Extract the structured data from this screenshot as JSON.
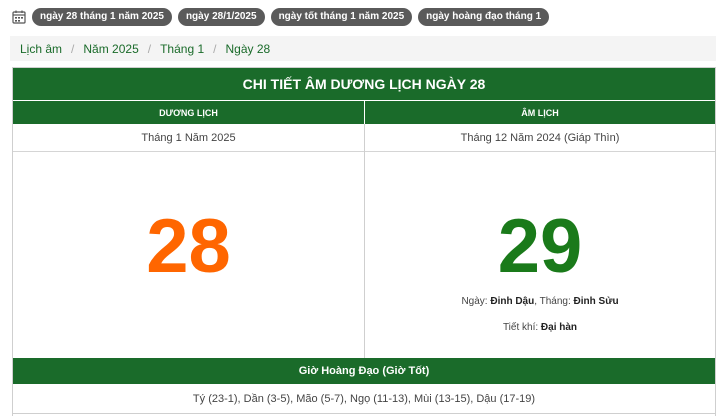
{
  "tags": [
    "ngày 28 tháng 1 năm 2025",
    "ngày 28/1/2025",
    "ngày tốt tháng 1 năm 2025",
    "ngày hoàng đạo tháng 1"
  ],
  "breadcrumb": [
    "Lịch âm",
    "Năm 2025",
    "Tháng 1",
    "Ngày 28"
  ],
  "title": "CHI TIẾT ÂM DƯƠNG LỊCH NGÀY 28",
  "solar": {
    "header": "DƯƠNG LỊCH",
    "month_year": "Tháng 1 Năm 2025",
    "day": "28"
  },
  "lunar": {
    "header": "ÂM LỊCH",
    "month_year": "Tháng 12 Năm 2024 (Giáp Thìn)",
    "day": "29",
    "day_label": "Ngày:",
    "day_canchi": "Đinh Dậu",
    "month_label": ", Tháng:",
    "month_canchi": "Đinh Sửu",
    "solar_term_label": "Tiết khí:",
    "solar_term": "Đại hàn"
  },
  "hours": {
    "header": "Giờ Hoàng Đạo (Giờ Tốt)",
    "list": "Tý (23-1), Dần (3-5), Mão (5-7), Ngọ (11-13), Mùi (13-15), Dậu (17-19)"
  },
  "colors": {
    "primary": "#1a6b2a",
    "solar_day": "#ff6600",
    "lunar_day": "#1a7a1a",
    "tag_bg": "#5a5a5a"
  }
}
